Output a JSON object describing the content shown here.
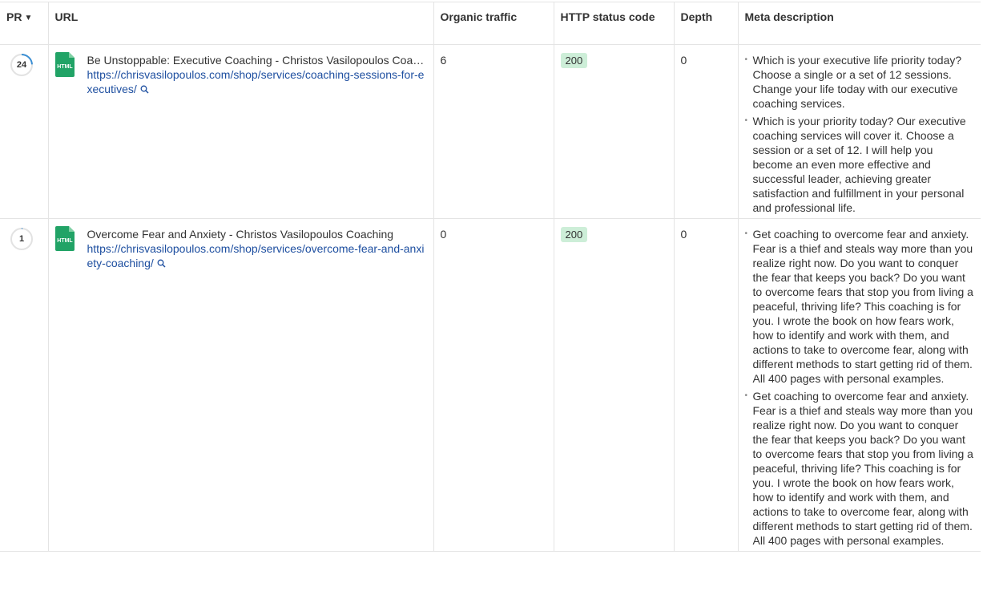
{
  "columns": {
    "pr": "PR",
    "url": "URL",
    "organic_traffic": "Organic traffic",
    "http_status": "HTTP status code",
    "depth": "Depth",
    "meta": "Meta description"
  },
  "rows": [
    {
      "pr": "24",
      "pr_fraction": 0.24,
      "icon": "html-file-icon",
      "icon_label": "HTML",
      "title": "Be Unstoppable: Executive Coaching - Christos Vasilopoulos Coaching",
      "url": "https://chrisvasilopoulos.com/shop/services/coaching-sessions-for-executives/",
      "organic_traffic": "6",
      "status": "200",
      "depth": "0",
      "meta": [
        "Which is your executive life priority today? Choose a single or a set of 12 sessions. Change your life today with our executive coaching services.",
        "Which is your priority today? Our executive coaching services will cover it. Choose a session or a set of 12. I will help you become an even more effective and successful leader, achieving greater satisfaction and fulfillment in your personal and professional life."
      ]
    },
    {
      "pr": "1",
      "pr_fraction": 0.01,
      "icon": "html-file-icon",
      "icon_label": "HTML",
      "title": "Overcome Fear and Anxiety - Christos Vasilopoulos Coaching",
      "url": "https://chrisvasilopoulos.com/shop/services/overcome-fear-and-anxiety-coaching/",
      "organic_traffic": "0",
      "status": "200",
      "depth": "0",
      "meta": [
        "Get coaching to overcome fear and anxiety. Fear is a thief and steals way more than you realize right now. Do you want to conquer the fear that keeps you back? Do you want to overcome fears that stop you from living a peaceful, thriving life? This coaching is for you. I wrote the book on how fears work, how to identify and work with them, and actions to take to overcome fear, along with different methods to start getting rid of them. All 400 pages with personal examples.",
        "Get coaching to overcome fear and anxiety. Fear is a thief and steals way more than you realize right now. Do you want to conquer the fear that keeps you back? Do you want to overcome fears that stop you from living a peaceful, thriving life? This coaching is for you. I wrote the book on how fears work, how to identify and work with them, and actions to take to overcome fear, along with different methods to start getting rid of them. All 400 pages with personal examples."
      ]
    }
  ],
  "colors": {
    "link": "#1e4fa0",
    "badge_bg": "#cdeed8",
    "pr_arc": "#3b8fd4",
    "html_icon": "#21a366"
  }
}
